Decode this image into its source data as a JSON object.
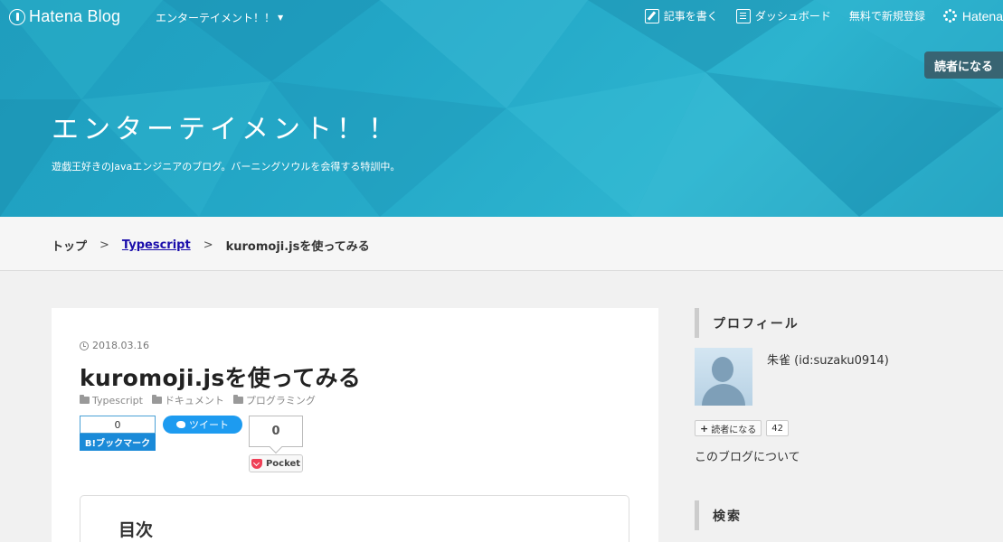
{
  "header": {
    "logo_text": "Hatena Blog",
    "blog_menu": "エンターテイメント！！",
    "nav": {
      "write": "記事を書く",
      "dashboard": "ダッシュボード",
      "signup": "無料で新規登録",
      "hatena": "Hatena"
    },
    "subscribe": "読者になる",
    "blog_title": "エンターテイメント！！",
    "blog_description": "遊戯王好きのJavaエンジニアのブログ。バーニングソウルを会得する特訓中。"
  },
  "breadcrumb": {
    "top": "トップ",
    "separator": ">",
    "category": "Typescript",
    "current": "kuromoji.jsを使ってみる"
  },
  "article": {
    "date": "2018.03.16",
    "title": "kuromoji.jsを使ってみる",
    "categories": [
      "Typescript",
      "ドキュメント",
      "プログラミング"
    ],
    "share": {
      "hatebu_count": "0",
      "hatebu_label": "B!ブックマーク",
      "tweet_label": "ツイート",
      "pocket_count": "0",
      "pocket_label": "Pocket"
    },
    "toc_title": "目次"
  },
  "sidebar": {
    "profile_heading": "プロフィール",
    "profile_name": "朱雀 (id:suzaku0914)",
    "subscribe_label": "読者になる",
    "subscriber_count": "42",
    "about_link": "このブログについて",
    "search_heading": "検索"
  },
  "colors": {
    "banner": "#22a6c6",
    "link": "#1a0dab",
    "hatebu": "#1a8ad8",
    "twitter": "#1d9bf0",
    "pocket": "#ef3f56"
  }
}
